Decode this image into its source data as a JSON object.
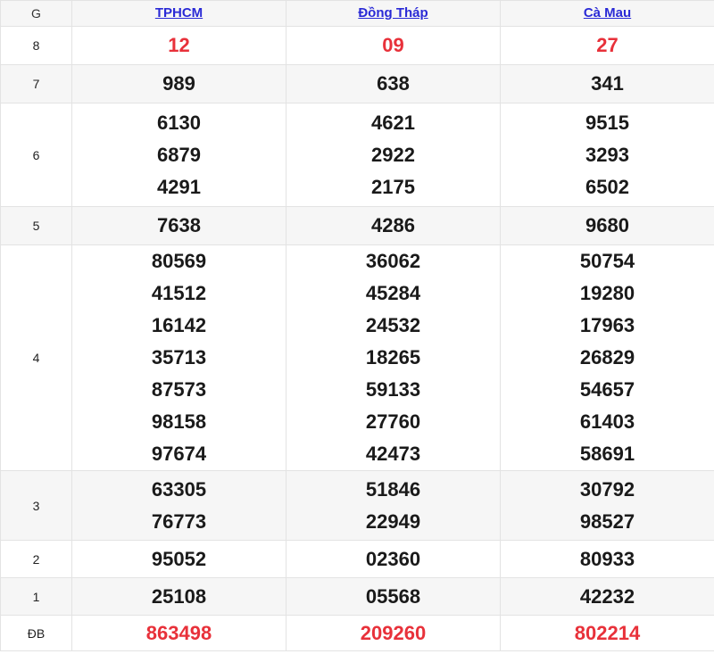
{
  "header": {
    "g_label": "G",
    "provinces": [
      "TPHCM",
      "Đồng Tháp",
      "Cà Mau"
    ]
  },
  "colors": {
    "red": "#e8313a",
    "link": "#2a2ad6"
  },
  "rows": [
    {
      "label": "8",
      "red": true,
      "values": [
        [
          "12"
        ],
        [
          "09"
        ],
        [
          "27"
        ]
      ]
    },
    {
      "label": "7",
      "red": false,
      "values": [
        [
          "989"
        ],
        [
          "638"
        ],
        [
          "341"
        ]
      ]
    },
    {
      "label": "6",
      "red": false,
      "values": [
        [
          "6130",
          "6879",
          "4291"
        ],
        [
          "4621",
          "2922",
          "2175"
        ],
        [
          "9515",
          "3293",
          "6502"
        ]
      ]
    },
    {
      "label": "5",
      "red": false,
      "values": [
        [
          "7638"
        ],
        [
          "4286"
        ],
        [
          "9680"
        ]
      ]
    },
    {
      "label": "4",
      "red": false,
      "values": [
        [
          "80569",
          "41512",
          "16142",
          "35713",
          "87573",
          "98158",
          "97674"
        ],
        [
          "36062",
          "45284",
          "24532",
          "18265",
          "59133",
          "27760",
          "42473"
        ],
        [
          "50754",
          "19280",
          "17963",
          "26829",
          "54657",
          "61403",
          "58691"
        ]
      ]
    },
    {
      "label": "3",
      "red": false,
      "values": [
        [
          "63305",
          "76773"
        ],
        [
          "51846",
          "22949"
        ],
        [
          "30792",
          "98527"
        ]
      ]
    },
    {
      "label": "2",
      "red": false,
      "values": [
        [
          "95052"
        ],
        [
          "02360"
        ],
        [
          "80933"
        ]
      ]
    },
    {
      "label": "1",
      "red": false,
      "values": [
        [
          "25108"
        ],
        [
          "05568"
        ],
        [
          "42232"
        ]
      ]
    },
    {
      "label": "ĐB",
      "red": true,
      "values": [
        [
          "863498"
        ],
        [
          "209260"
        ],
        [
          "802214"
        ]
      ]
    }
  ]
}
